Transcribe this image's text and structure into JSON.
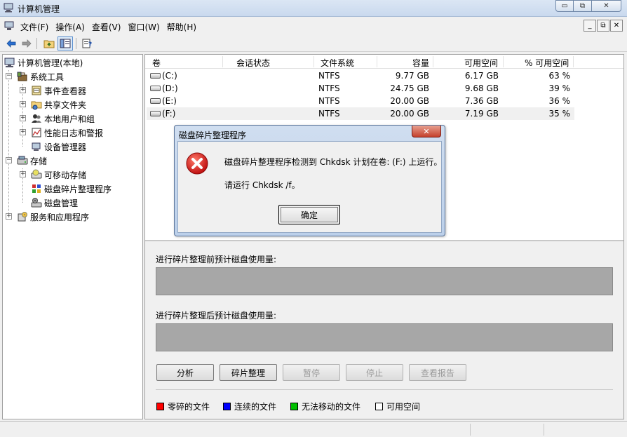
{
  "window": {
    "title": "计算机管理",
    "minimize_glyph": "▭",
    "maximize_glyph": "⧉",
    "close_glyph": "✕"
  },
  "menu": {
    "items": [
      "文件(F)",
      "操作(A)",
      "查看(V)",
      "窗口(W)",
      "帮助(H)"
    ],
    "mdi_min": "_",
    "mdi_restore": "⧉",
    "mdi_close": "✕"
  },
  "toolbar": {
    "icons": [
      "back-arrow-icon",
      "forward-arrow-icon",
      "up-folder-icon",
      "show-hide-tree-icon",
      "help-properties-icon"
    ]
  },
  "tree": {
    "root": "计算机管理(本地)",
    "system_tools": "系统工具",
    "event_viewer": "事件查看器",
    "shared_folders": "共享文件夹",
    "local_users": "本地用户和组",
    "perf_logs": "性能日志和警报",
    "device_manager": "设备管理器",
    "storage": "存储",
    "removable_storage": "可移动存储",
    "disk_defrag": "磁盘碎片整理程序",
    "disk_management": "磁盘管理",
    "services_apps": "服务和应用程序"
  },
  "volumes": {
    "columns": {
      "volume": "卷",
      "session_status": "会话状态",
      "file_system": "文件系统",
      "capacity": "容量",
      "free_space": "可用空间",
      "pct_free": "% 可用空间"
    },
    "rows": [
      {
        "volume": "(C:)",
        "status": "",
        "fs": "NTFS",
        "capacity": "9.77 GB",
        "free": "6.17 GB",
        "pct": "63 %"
      },
      {
        "volume": "(D:)",
        "status": "",
        "fs": "NTFS",
        "capacity": "24.75 GB",
        "free": "9.68 GB",
        "pct": "39 %"
      },
      {
        "volume": "(E:)",
        "status": "",
        "fs": "NTFS",
        "capacity": "20.00 GB",
        "free": "7.36 GB",
        "pct": "36 %"
      },
      {
        "volume": "(F:)",
        "status": "",
        "fs": "NTFS",
        "capacity": "20.00 GB",
        "free": "7.19 GB",
        "pct": "35 %"
      }
    ]
  },
  "analysis": {
    "before_label": "进行碎片整理前预计磁盘使用量:",
    "after_label": "进行碎片整理后预计磁盘使用量:",
    "buttons": {
      "analyze": "分析",
      "defragment": "碎片整理",
      "pause": "暂停",
      "stop": "停止",
      "view_report": "查看报告"
    },
    "legend": {
      "fragmented": "零碎的文件",
      "contiguous": "连续的文件",
      "unmovable": "无法移动的文件",
      "free": "可用空间"
    },
    "colors": {
      "fragmented": "#ff0000",
      "contiguous": "#0000ff",
      "unmovable": "#00c000",
      "free": "#ffffff"
    }
  },
  "dialog": {
    "title": "磁盘碎片整理程序",
    "message1": "磁盘碎片整理程序检测到 Chkdsk 计划在卷: (F:) 上运行。",
    "message2": "请运行 Chkdsk /f。",
    "ok": "确定",
    "close_glyph": "✕",
    "icon": "error-icon"
  }
}
